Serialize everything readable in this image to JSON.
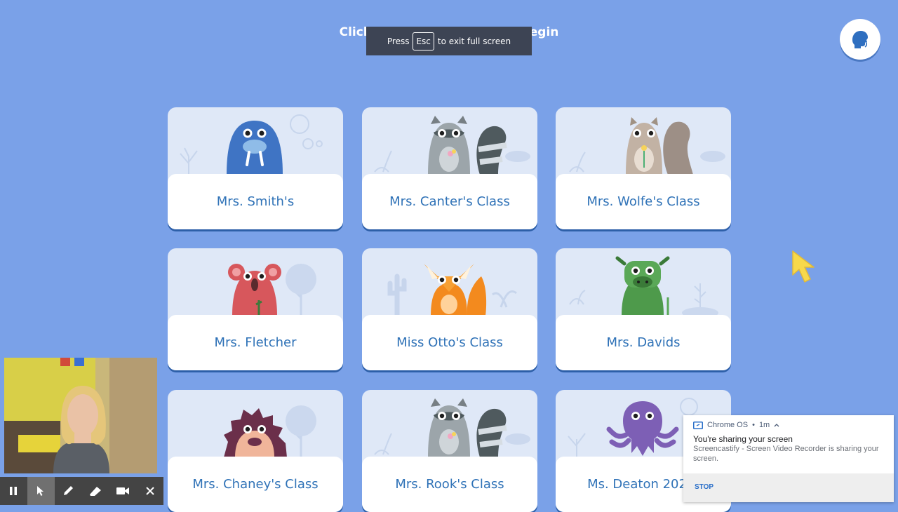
{
  "header": {
    "title": "Click on your classroom to begin",
    "esc_banner": {
      "prefix": "Press",
      "key": "Esc",
      "suffix": "to exit full screen"
    }
  },
  "voice_button": {
    "icon": "speaking-head-icon"
  },
  "classes": [
    {
      "label": "Mrs. Smith's",
      "animal": "walrus",
      "color": "#3f74c4"
    },
    {
      "label": "Mrs. Canter's Class",
      "animal": "raccoon",
      "color": "#9ca5aa"
    },
    {
      "label": "Mrs. Wolfe's Class",
      "animal": "squirrel",
      "color": "#c2b2a4"
    },
    {
      "label": "Mrs. Fletcher",
      "animal": "koala",
      "color": "#d7575c"
    },
    {
      "label": "Miss Otto's Class",
      "animal": "fox",
      "color": "#f38a1e"
    },
    {
      "label": "Mrs. Davids",
      "animal": "cow",
      "color": "#4e9a4b"
    },
    {
      "label": "Mrs. Chaney's Class",
      "animal": "hedgehog",
      "color": "#7a3a55"
    },
    {
      "label": "Mrs. Rook's Class",
      "animal": "raccoon",
      "color": "#9ca5aa"
    },
    {
      "label": "Ms. Deaton 2020-",
      "animal": "octopus",
      "color": "#7d5fb5"
    }
  ],
  "recorder_toolbar": {
    "buttons": [
      "pause-icon",
      "pointer-icon",
      "pen-icon",
      "eraser-icon",
      "camera-icon",
      "close-icon"
    ]
  },
  "notification": {
    "source": "Chrome OS",
    "time": "1m",
    "title": "You're sharing your screen",
    "body": "Screencastify - Screen Video Recorder is sharing your screen.",
    "action": "STOP"
  },
  "colors": {
    "background": "#7aa1e8",
    "card_label": "#2f72b7",
    "cursor": "#f7d94b",
    "notification_action": "#2a6fc9"
  }
}
